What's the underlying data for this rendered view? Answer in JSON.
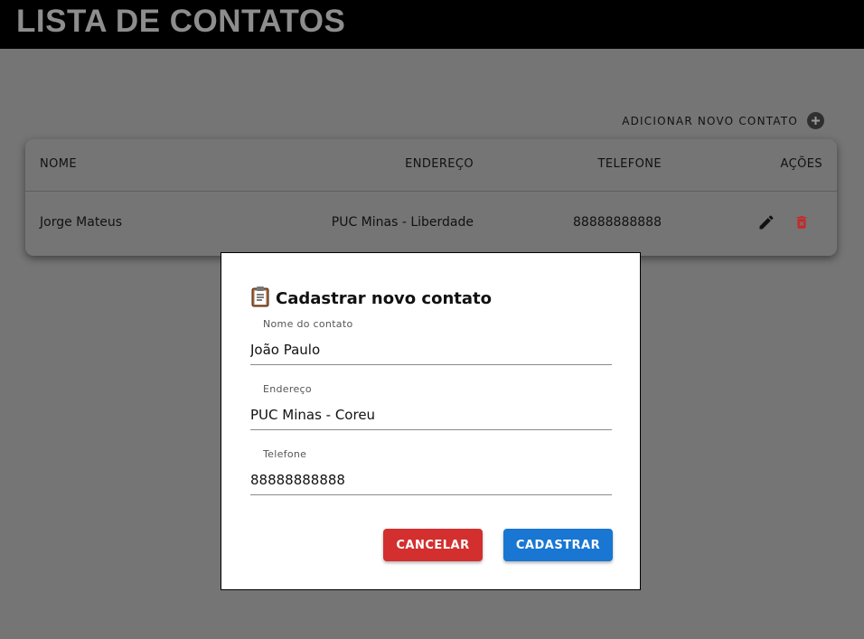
{
  "app": {
    "title": "LISTA DE CONTATOS"
  },
  "actions": {
    "add_contact_label": "ADICIONAR NOVO CONTATO",
    "add_icon": "plus-circle-icon"
  },
  "table": {
    "columns": {
      "name": "NOME",
      "address": "ENDEREÇO",
      "phone": "TELEFONE",
      "actions": "AÇÕES"
    },
    "rows": [
      {
        "name": "Jorge Mateus",
        "address": "PUC Minas - Liberdade",
        "phone": "88888888888"
      }
    ]
  },
  "modal": {
    "title": "Cadastrar novo contato",
    "title_icon": "clipboard-icon",
    "fields": {
      "name": {
        "label": "Nome do contato",
        "value": "João Paulo"
      },
      "address": {
        "label": "Endereço",
        "value": "PUC Minas - Coreu"
      },
      "phone": {
        "label": "Telefone",
        "value": "88888888888"
      }
    },
    "buttons": {
      "cancel": "CANCELAR",
      "submit": "CADASTRAR"
    }
  },
  "colors": {
    "topbar": "#000000",
    "backdrop": "#757575",
    "cancel": "#d32f2f",
    "submit": "#1976d2",
    "delete_icon": "#c62828"
  }
}
